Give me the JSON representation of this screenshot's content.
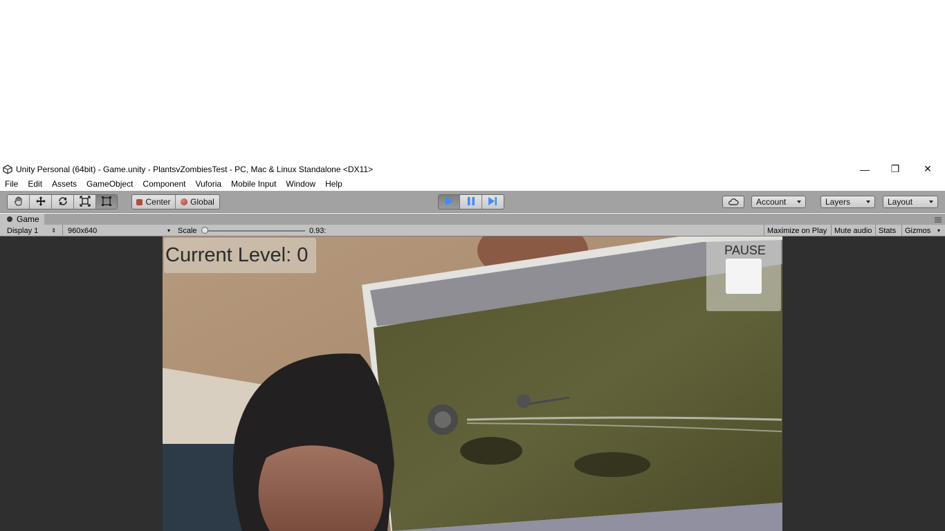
{
  "window": {
    "title": "Unity Personal (64bit) - Game.unity - PlantsvZombiesTest - PC, Mac & Linux Standalone <DX11>",
    "minimize_glyph": "—",
    "maximize_glyph": "❐",
    "close_glyph": "✕"
  },
  "menu": {
    "items": [
      "File",
      "Edit",
      "Assets",
      "GameObject",
      "Component",
      "Vuforia",
      "Mobile Input",
      "Window",
      "Help"
    ]
  },
  "toolbar": {
    "tools": [
      "hand-icon",
      "move-icon",
      "rotate-icon",
      "scale-icon",
      "rect-icon"
    ],
    "pivot_label": "Center",
    "space_label": "Global",
    "account_label": "Account",
    "layers_label": "Layers",
    "layout_label": "Layout",
    "accent_color": "#3c8cff"
  },
  "tab": {
    "label": "Game"
  },
  "gamebar": {
    "display": "Display 1",
    "resolution": "960x640",
    "scale_label": "Scale",
    "scale_value": "0.93:",
    "scale_slider_fraction": 0.0,
    "maximize_label": "Maximize on Play",
    "mute_label": "Mute audio",
    "stats_label": "Stats",
    "gizmos_label": "Gizmos"
  },
  "game": {
    "level_text": "Current Level: 0",
    "pause_label": "PAUSE"
  }
}
